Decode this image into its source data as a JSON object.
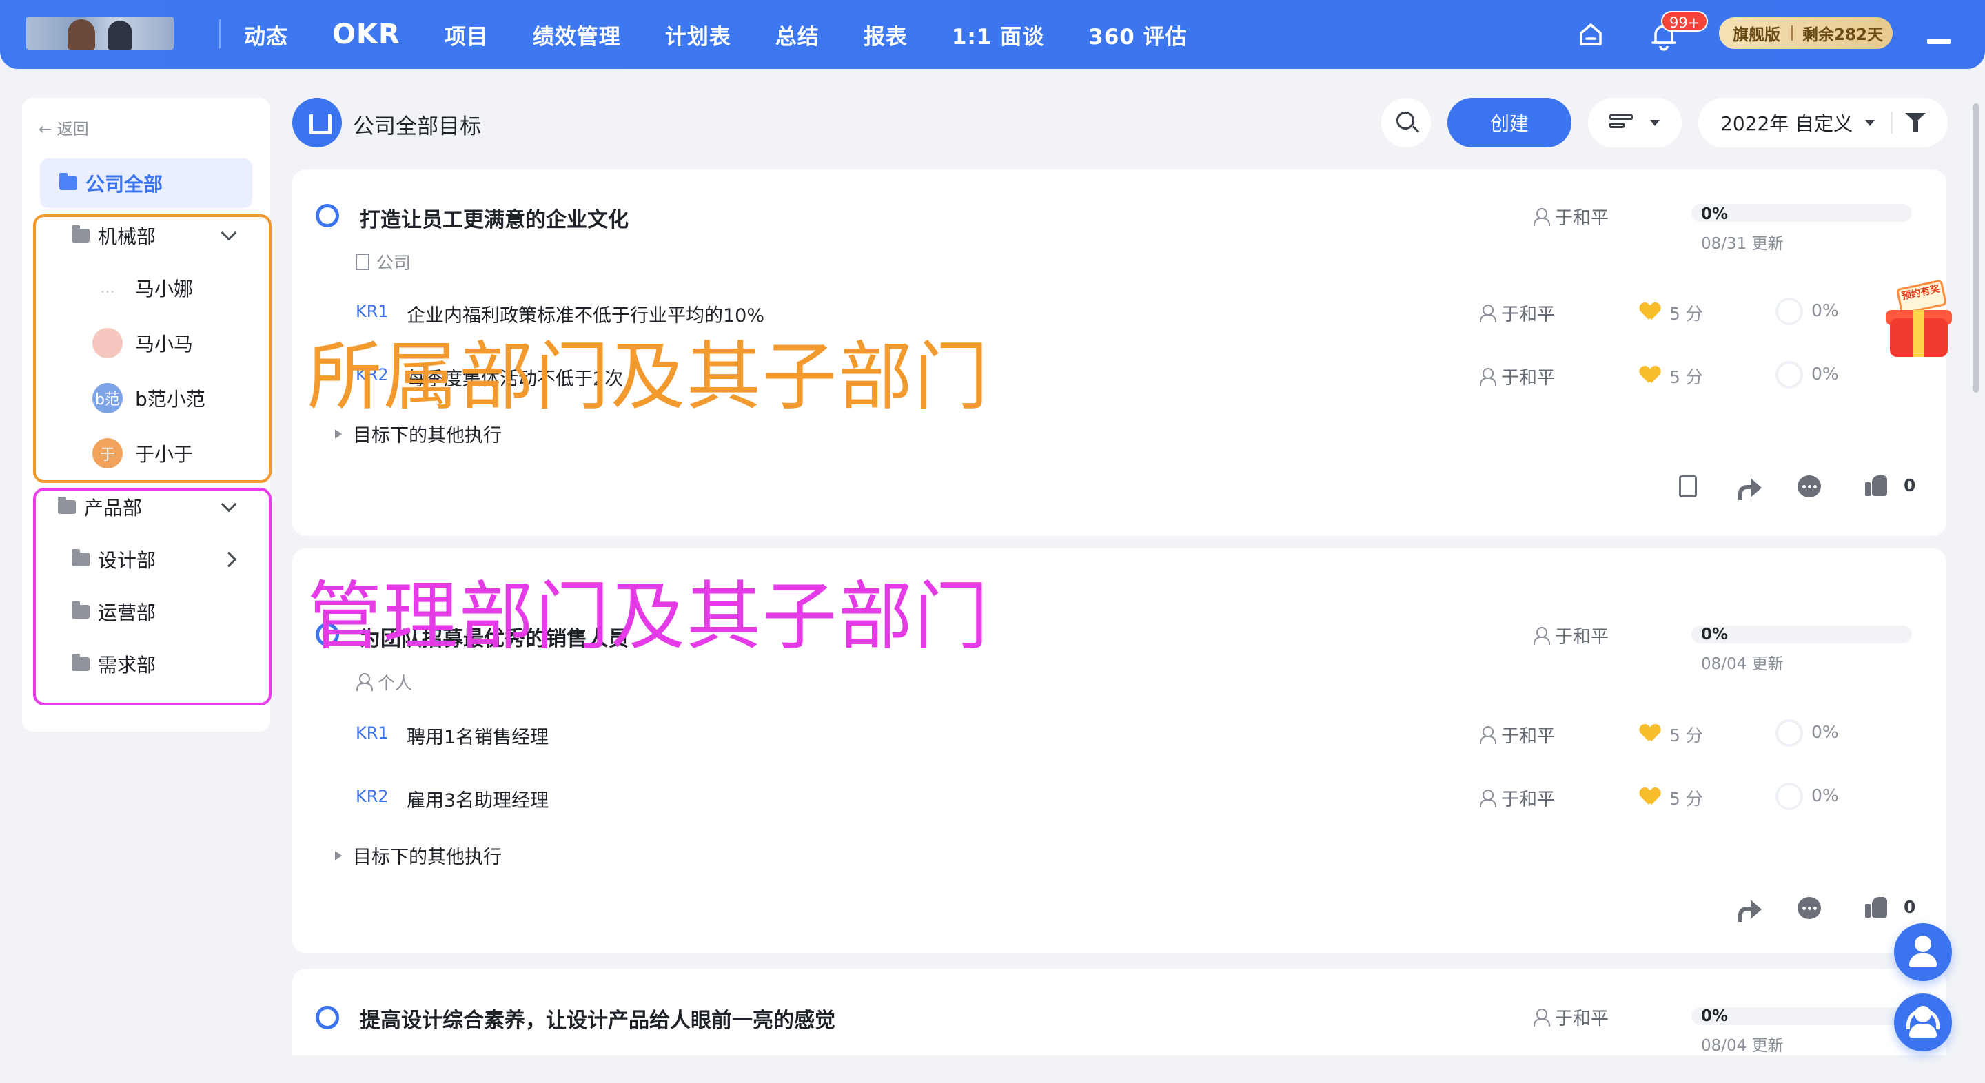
{
  "nav": {
    "items": [
      "动态",
      "OKR",
      "项目",
      "绩效管理",
      "计划表",
      "总结",
      "报表",
      "1:1 面谈",
      "360 评估"
    ],
    "active_index": 1,
    "notification_badge": "99+",
    "vip_label": "旗舰版",
    "vip_remaining": "剩余282天",
    "home_icon": "home-icon",
    "bell_icon": "bell-icon"
  },
  "sidebar": {
    "back_label": "返回",
    "active_item": "公司全部",
    "dept1": {
      "name": "机械部",
      "members": [
        {
          "name": "马小娜",
          "avatar": "",
          "color": "#ffffff"
        },
        {
          "name": "马小马",
          "avatar": "",
          "color": "#f0a9a0"
        },
        {
          "name": "b范小范",
          "avatar": "b范",
          "color": "#7ea4e8"
        },
        {
          "name": "于小于",
          "avatar": "于",
          "color": "#f2a35b"
        }
      ]
    },
    "dept2": {
      "name": "产品部",
      "children": [
        "设计部",
        "运营部",
        "需求部"
      ]
    }
  },
  "header": {
    "title": "公司全部目标",
    "create_label": "创建",
    "period_label": "2022年 自定义"
  },
  "objectives": [
    {
      "title": "打造让员工更满意的企业文化",
      "owner": "于和平",
      "progress": "0%",
      "progress_value": 0,
      "updated": "08/31 更新",
      "scope": "公司",
      "krs": [
        {
          "label": "KR1",
          "text": "企业内福利政策标准不低于行业平均的10%",
          "owner": "于和平",
          "score": "5 分",
          "pct": "0%"
        },
        {
          "label": "KR2",
          "text": "每季度集体活动不低于2次",
          "owner": "于和平",
          "score": "5 分",
          "pct": "0%"
        }
      ],
      "exec_label": "目标下的其他执行",
      "likes": "0"
    },
    {
      "title": "为团队招募最优秀的销售人员",
      "owner": "于和平",
      "progress": "0%",
      "progress_value": 0,
      "updated": "08/04 更新",
      "scope": "个人",
      "krs": [
        {
          "label": "KR1",
          "text": "聘用1名销售经理",
          "owner": "于和平",
          "score": "5 分",
          "pct": "0%"
        },
        {
          "label": "KR2",
          "text": "雇用3名助理经理",
          "owner": "于和平",
          "score": "5 分",
          "pct": "0%"
        }
      ],
      "exec_label": "目标下的其他执行",
      "likes": "0"
    },
    {
      "title": "提高设计综合素养，让设计产品给人眼前一亮的感觉",
      "owner": "于和平",
      "progress": "0%",
      "progress_value": 0,
      "updated": "08/04 更新"
    }
  ],
  "gift": {
    "sign": "预约有奖"
  },
  "annotations": {
    "orange": "所属部门及其子部门",
    "pink": "管理部门及其子部门",
    "colors": {
      "orange": "#f39a2e",
      "pink": "#e43be6"
    }
  },
  "colors": {
    "accent": "#3b74ee",
    "background": "#f1f3f7"
  }
}
